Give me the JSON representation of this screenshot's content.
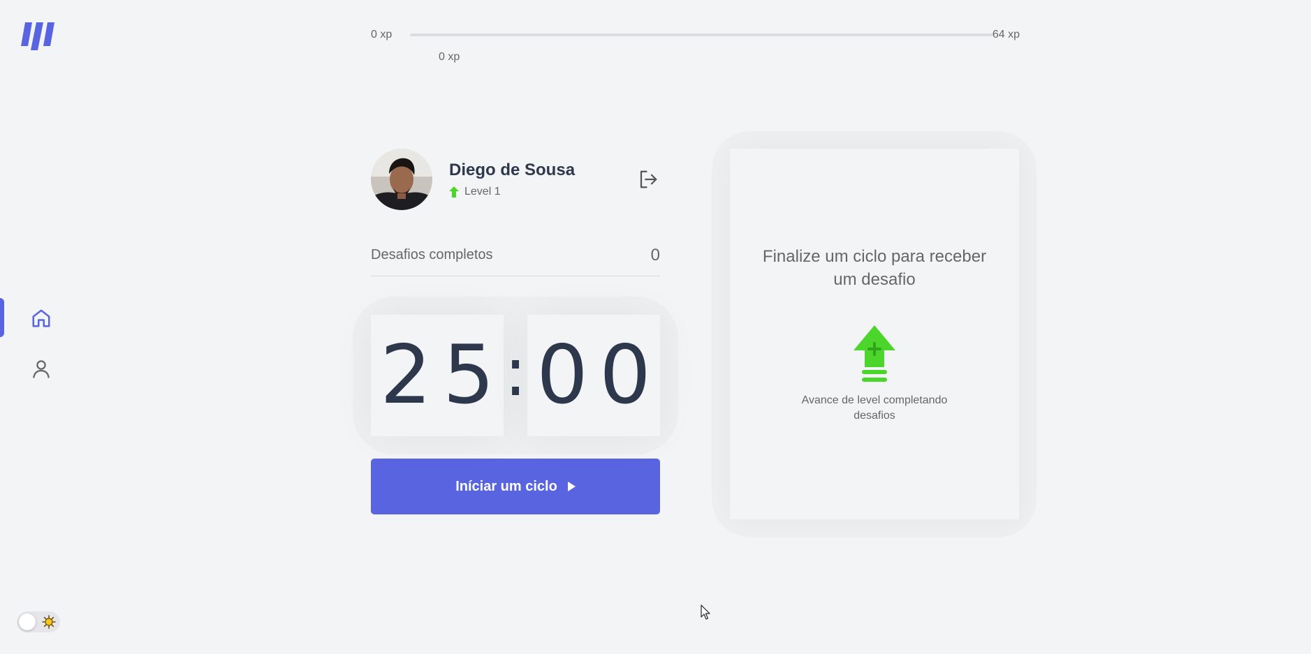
{
  "sidebar": {
    "logo_icon": "brand-logo-icon",
    "nav": [
      {
        "name": "home",
        "icon": "home-icon",
        "active": true
      },
      {
        "name": "profile",
        "icon": "user-icon",
        "active": false
      }
    ],
    "theme_toggle": {
      "icon": "sun-icon",
      "state": "light"
    }
  },
  "xp": {
    "min_label": "0 xp",
    "max_label": "64 xp",
    "current_label": "0 xp",
    "progress_fraction": 0
  },
  "profile": {
    "name": "Diego de Sousa",
    "level_label": "Level 1",
    "logout_icon": "logout-icon"
  },
  "stats": {
    "completed_label": "Desafios completos",
    "completed_count": "0"
  },
  "countdown": {
    "minutes": [
      "2",
      "5"
    ],
    "separator": ":",
    "seconds": [
      "0",
      "0"
    ]
  },
  "start_button": {
    "label": "Iníciar um ciclo",
    "icon": "play-icon"
  },
  "challenge": {
    "title": "Finalize um ciclo para receber um desafio",
    "hint": "Avance de level completando desafios",
    "icon": "level-up-icon"
  },
  "colors": {
    "accent": "#5965e0",
    "green": "#4cd62b",
    "text": "#2e384d",
    "muted": "#666666",
    "background": "#f3f4f6"
  }
}
